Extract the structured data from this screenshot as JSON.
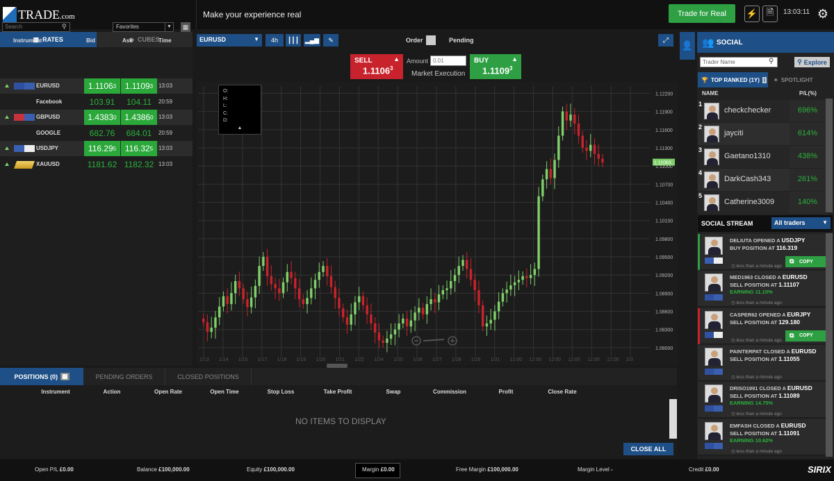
{
  "header": {
    "logo_text": "TRADE",
    "logo_domain": ".com",
    "slogan": "Make your experience real",
    "trade_real_label": "Trade for Real",
    "clock": "13:03:11"
  },
  "rates": {
    "tab_rates": "RATES",
    "tab_cubes": "CUBES",
    "search_placeholder": "Search",
    "list_select": "Favorites",
    "col_instrument": "Instrument ↑",
    "col_bid": "Bid",
    "col_ask": "Ask",
    "col_time": "Time",
    "rows": [
      {
        "name": "EURUSD",
        "bid_main": "1.1106",
        "bid_sup": "3",
        "ask_main": "1.1109",
        "ask_sup": "3",
        "time": "13:03",
        "active": true,
        "f1": "#2f4fa0",
        "f2": "#3a5fb0"
      },
      {
        "name": "Facebook",
        "bid_main": "103.91",
        "bid_sup": "",
        "ask_main": "104.11",
        "ask_sup": "",
        "time": "20:59",
        "active": false
      },
      {
        "name": "GBPUSD",
        "bid_main": "1.4383",
        "bid_sup": "0",
        "ask_main": "1.4386",
        "ask_sup": "0",
        "time": "13:03",
        "active": true,
        "f1": "#c8323c",
        "f2": "#3a5fb0"
      },
      {
        "name": "GOOGLE",
        "bid_main": "682.76",
        "bid_sup": "",
        "ask_main": "684.01",
        "ask_sup": "",
        "time": "20:59",
        "active": false
      },
      {
        "name": "USDJPY",
        "bid_main": "116.29",
        "bid_sup": "5",
        "ask_main": "116.32",
        "ask_sup": "5",
        "time": "13:03",
        "active": true,
        "f1": "#3a5fb0",
        "f2": "#eeeeee"
      },
      {
        "name": "XAUUSD",
        "bid_main": "1181.62",
        "bid_sup": "",
        "ask_main": "1182.32",
        "ask_sup": "",
        "time": "13:03",
        "active": false
      }
    ]
  },
  "chart_toolbar": {
    "symbol": "EURUSD",
    "timeframe": "4h",
    "order_label": "Order",
    "pending_label": "Pending"
  },
  "trade": {
    "sell_label": "SELL",
    "sell_price_main": "1.1106",
    "sell_price_sup": "3",
    "buy_label": "BUY",
    "buy_price_main": "1.1109",
    "buy_price_sup": "3",
    "amount_label": "Amount",
    "amount_value": "0.01",
    "execution": "Market Execution"
  },
  "ohlc": {
    "o": "O:",
    "h": "H:",
    "l": "L:",
    "c": "C:",
    "d": "D:"
  },
  "chart_data": {
    "type": "candlestick",
    "symbol": "EURUSD",
    "y_ticks": [
      "1.12200",
      "1.11900",
      "1.11600",
      "1.11300",
      "1.11000",
      "1.10700",
      "1.10400",
      "1.10100",
      "1.09800",
      "1.09500",
      "1.09200",
      "1.08900",
      "1.08600",
      "1.08300",
      "1.08000"
    ],
    "ylim": [
      1.0785,
      1.1232
    ],
    "current_price": "1.11063",
    "x_ticks": [
      "1/13",
      "1/14",
      "1/15",
      "1/17",
      "1/18",
      "1/19",
      "1/20",
      "1/21",
      "1/22",
      "1/24",
      "1/25",
      "1/26",
      "1/27",
      "1/28",
      "1/29",
      "1/31",
      "12:00",
      "12:00",
      "12:00",
      "12:00",
      "12:00",
      "12:00",
      "2/3"
    ],
    "closes": [
      1.0842,
      1.0826,
      1.0833,
      1.085,
      1.0868,
      1.0885,
      1.0872,
      1.089,
      1.091,
      1.0898,
      1.088,
      1.0867,
      1.0883,
      1.0902,
      1.0935,
      1.095,
      1.0918,
      1.0905,
      1.0898,
      1.089,
      1.0908,
      1.0925,
      1.0915,
      1.0898,
      1.088,
      1.0872,
      1.0882,
      1.0898,
      1.0912,
      1.0925,
      1.0935,
      1.0918,
      1.09,
      1.0882,
      1.0865,
      1.085,
      1.0838,
      1.0855,
      1.0875,
      1.0885,
      1.087,
      1.0855,
      1.084,
      1.0825,
      1.0812,
      1.0808,
      1.0815,
      1.0822,
      1.083,
      1.084,
      1.0848,
      1.0835,
      1.0845,
      1.0858,
      1.0866,
      1.0855,
      1.0872,
      1.088,
      1.0875,
      1.0888,
      1.0895,
      1.0898,
      1.091,
      1.092,
      1.0935,
      1.0945,
      1.093,
      1.0912,
      1.0895,
      1.087,
      1.0835,
      1.084,
      1.0846,
      1.086,
      1.0876,
      1.089,
      1.0896,
      1.0903,
      1.0908,
      1.0912,
      1.0918,
      1.0915,
      1.092,
      1.093,
      1.105,
      1.1078,
      1.1095,
      1.108,
      1.111,
      1.115,
      1.119,
      1.1175,
      1.1185,
      1.117,
      1.115,
      1.113,
      1.1125,
      1.1135,
      1.112,
      1.1112,
      1.1106
    ],
    "grid": true
  },
  "bottom": {
    "tab_positions": "POSITIONS (0)",
    "tab_pending": "PENDING ORDERS",
    "tab_closed": "CLOSED POSITIONS",
    "columns": [
      "Instrument",
      "Action",
      "Open Rate",
      "Open Time",
      "Stop Loss",
      "Take Profit",
      "Swap",
      "Commission",
      "Profit",
      "Close Rate"
    ],
    "empty": "NO ITEMS TO DISPLAY",
    "close_all": "CLOSE ALL"
  },
  "footer": {
    "open_pl_label": "Open P/L",
    "open_pl": "£0.00",
    "balance_label": "Balance",
    "balance": "£100,000.00",
    "equity_label": "Equity",
    "equity": "£100,000.00",
    "margin_label": "Margin",
    "margin": "£0.00",
    "free_margin_label": "Free Margin",
    "free_margin": "£100,000.00",
    "margin_level_label": "Margin Level",
    "margin_level": "-",
    "credit_label": "Credit",
    "credit": "£0.00",
    "brand": "SIRIX"
  },
  "social": {
    "title": "SOCIAL",
    "trader_placeholder": "Trader Name",
    "explore": "Explore",
    "tab_top": "TOP RANKED (1Y)",
    "tab_spot": "SPOTLIGHT",
    "col_name": "NAME",
    "col_pl": "P/L(%)",
    "traders": [
      {
        "rank": "1",
        "name": "checkchecker",
        "pl": "696%"
      },
      {
        "rank": "2",
        "name": "jayciti",
        "pl": "614%"
      },
      {
        "rank": "3",
        "name": "Gaetano1310",
        "pl": "438%"
      },
      {
        "rank": "4",
        "name": "DarkCash343",
        "pl": "261%"
      },
      {
        "rank": "5",
        "name": "Catherine3009",
        "pl": "140%"
      }
    ],
    "stream_title": "SOCIAL STREAM",
    "stream_filter": "All traders",
    "stream": [
      {
        "pre": "DELIUTA OPENED A ",
        "sym": "USDJPY",
        "post": " BUY POSITION AT ",
        "rate": "116.319",
        "earning": "",
        "ago": "less than a minute ago",
        "copy": "COPY",
        "bar": "#2ea043"
      },
      {
        "pre": "MED1963 CLOSED A ",
        "sym": "EURUSD",
        "post": " SELL POSITION AT ",
        "rate": "1.11107",
        "earning": "EARNING 11.15%",
        "ago": "less than a minute ago",
        "copy": "",
        "bar": ""
      },
      {
        "pre": "CASPER62 OPENED A ",
        "sym": "EURJPY",
        "post": " SELL POSITION AT ",
        "rate": "129.180",
        "earning": "",
        "ago": "less than a minute ago",
        "copy": "COPY",
        "bar": "#c8232c"
      },
      {
        "pre": "PAINTERPAT CLOSED A ",
        "sym": "EURUSD",
        "post": " SELL POSITION AT ",
        "rate": "1.11055",
        "earning": "",
        "ago": "less than a minute ago",
        "copy": "",
        "bar": ""
      },
      {
        "pre": "DRISO1991 CLOSED A ",
        "sym": "EURUSD",
        "post": " SELL POSITION AT ",
        "rate": "1.11089",
        "earning": "EARNING 14.75%",
        "ago": "less than a minute ago",
        "copy": "",
        "bar": ""
      },
      {
        "pre": "EMFASH CLOSED A ",
        "sym": "EURUSD",
        "post": " SELL POSITION AT ",
        "rate": "1.11091",
        "earning": "EARNING 10.62%",
        "ago": "less than a minute ago",
        "copy": "",
        "bar": ""
      }
    ]
  }
}
